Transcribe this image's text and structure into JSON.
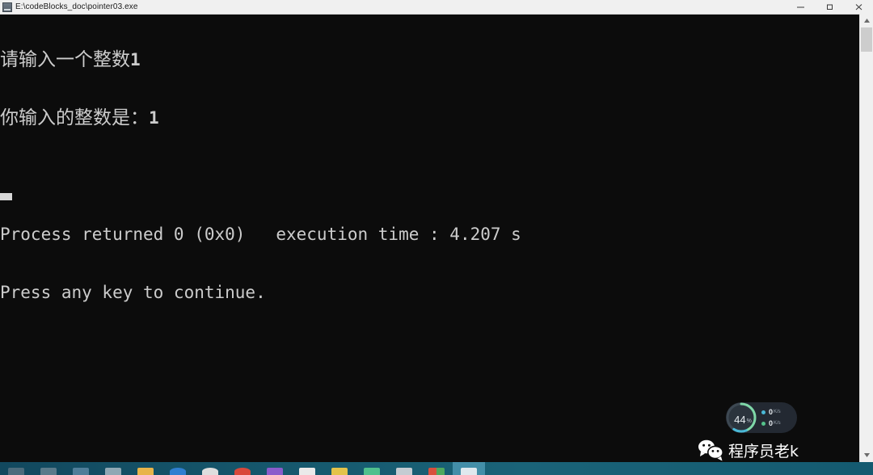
{
  "window": {
    "title": "E:\\codeBlocks_doc\\pointer03.exe",
    "icon": "console-icon",
    "controls": {
      "minimize_label": "─",
      "maximize_label": "❐",
      "close_label": "✕"
    }
  },
  "console": {
    "background_color": "#0c0c0c",
    "text_color": "#cccccc",
    "lines": [
      {
        "id": "prompt",
        "cjk": "请输入一个整数",
        "value": "1"
      },
      {
        "id": "echo",
        "cjk": "你输入的整数是：",
        "value": "1"
      },
      {
        "id": "blank",
        "text": ""
      },
      {
        "id": "process",
        "text": "Process returned 0 (0x0)   execution time : 4.207 s"
      },
      {
        "id": "press",
        "text": "Press any key to continue."
      }
    ],
    "prompt_line": "请输入一个整数",
    "prompt_value": "1",
    "echo_line": "你输入的整数是：",
    "echo_value": "1",
    "process_line": "Process returned 0 (0x0)   execution time : 4.207 s",
    "press_line": "Press any key to continue.",
    "cursor": "block-cursor"
  },
  "scrollbar": {
    "up_arrow": "▲",
    "down_arrow": "▼"
  },
  "system_monitor": {
    "cpu_value": "44",
    "cpu_unit": "%",
    "accent_color": "#7fd8a8",
    "network": [
      {
        "direction": "upload",
        "value": "0",
        "unit": "K/s",
        "color": "#4ab8d6"
      },
      {
        "direction": "download",
        "value": "0",
        "unit": "K/s",
        "color": "#54c28a"
      }
    ]
  },
  "watermark": {
    "logo": "wechat-logo",
    "text": "程序员老k"
  },
  "taskbar": {
    "items": [
      {
        "name": "search",
        "color": "#4b6b7c"
      },
      {
        "name": "task-view",
        "color": "#5a7a8a"
      },
      {
        "name": "explorer-blue",
        "color": "#4f7e99"
      },
      {
        "name": "app-grid",
        "color": "#8fa8b4"
      },
      {
        "name": "file-explorer",
        "color": "#e8b44a"
      },
      {
        "name": "edge-browser",
        "color": "#2f7fd0"
      },
      {
        "name": "chrome-browser",
        "color": "#dedede"
      },
      {
        "name": "media-player",
        "color": "#d9483b"
      },
      {
        "name": "purple-app",
        "color": "#8a5ccb"
      },
      {
        "name": "white-app",
        "color": "#eaeaea"
      },
      {
        "name": "yellow-app",
        "color": "#e3c34a"
      },
      {
        "name": "green-app",
        "color": "#4fc08d"
      },
      {
        "name": "grey-app",
        "color": "#c4ccd2"
      },
      {
        "name": "office-app",
        "color": "#d94f3d"
      },
      {
        "name": "console-active",
        "color": "#dfe9ee",
        "active": true
      }
    ]
  }
}
